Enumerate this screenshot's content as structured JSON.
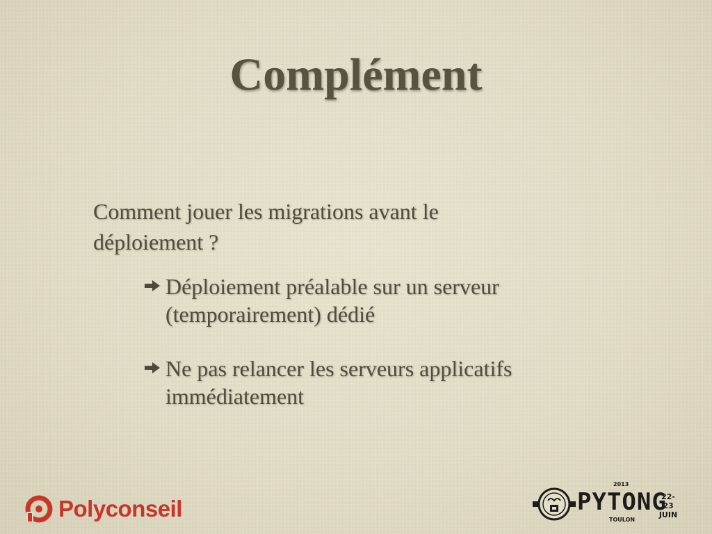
{
  "slide": {
    "title": "Complément",
    "question": "Comment jouer les migrations avant le déploiement ?",
    "bullets": [
      {
        "text": "Déploiement préalable sur un serveur (temporairement) dédié",
        "icon": "arrow-right-icon"
      },
      {
        "text": "Ne pas relancer les serveurs applicatifs immédiatement",
        "icon": "arrow-right-icon"
      }
    ]
  },
  "footer": {
    "left_logo": {
      "brand": "Polyconseil",
      "icon": "polyconseil-logo-icon",
      "color": "#c8362a"
    },
    "right_logo": {
      "name": "PYTONG",
      "year": "2013",
      "city": "TOULON",
      "dates_line1": "22-23",
      "dates_line2": "JUIN",
      "icon": "pytong-badge-icon"
    }
  },
  "colors": {
    "background": "#e4dfc9",
    "text": "#514c3d",
    "title": "#58533f"
  }
}
